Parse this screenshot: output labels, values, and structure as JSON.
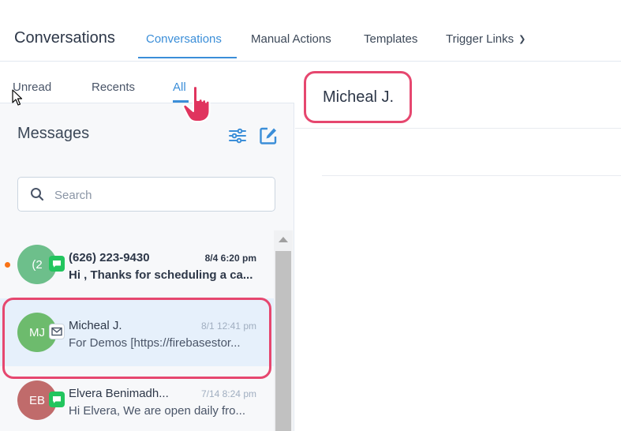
{
  "topnav": {
    "app_title": "Conversations",
    "tabs": [
      {
        "label": "Conversations"
      },
      {
        "label": "Manual Actions"
      },
      {
        "label": "Templates"
      },
      {
        "label": "Trigger Links"
      }
    ],
    "accent_color": "#3b8ed8"
  },
  "subtabs": [
    {
      "label": "Unread"
    },
    {
      "label": "Recents"
    },
    {
      "label": "All"
    }
  ],
  "messages": {
    "title": "Messages",
    "search_placeholder": "Search",
    "filter_icon": "sliders-icon",
    "compose_icon": "compose-icon",
    "items": [
      {
        "initials": "(2",
        "name": "(626) 223-9430",
        "time": "8/4 6:20 pm",
        "preview": "Hi , Thanks for scheduling a ca...",
        "unread": true,
        "channel": "sms",
        "avatar_color": "#6dbf8b"
      },
      {
        "initials": "MJ",
        "name": "Micheal J.",
        "time": "8/1 12:41 pm",
        "preview": "For Demos [https://firebasestor...",
        "unread": false,
        "channel": "email",
        "avatar_color": "#6dbb6d"
      },
      {
        "initials": "EB",
        "name": "Elvera Benimadh...",
        "time": "7/14 8:24 pm",
        "preview": "Hi Elvera, We are open daily fro...",
        "unread": false,
        "channel": "sms",
        "avatar_color": "#c06b6b"
      }
    ]
  },
  "contact": {
    "name": "Micheal J."
  },
  "highlight_color": "#e6476f"
}
